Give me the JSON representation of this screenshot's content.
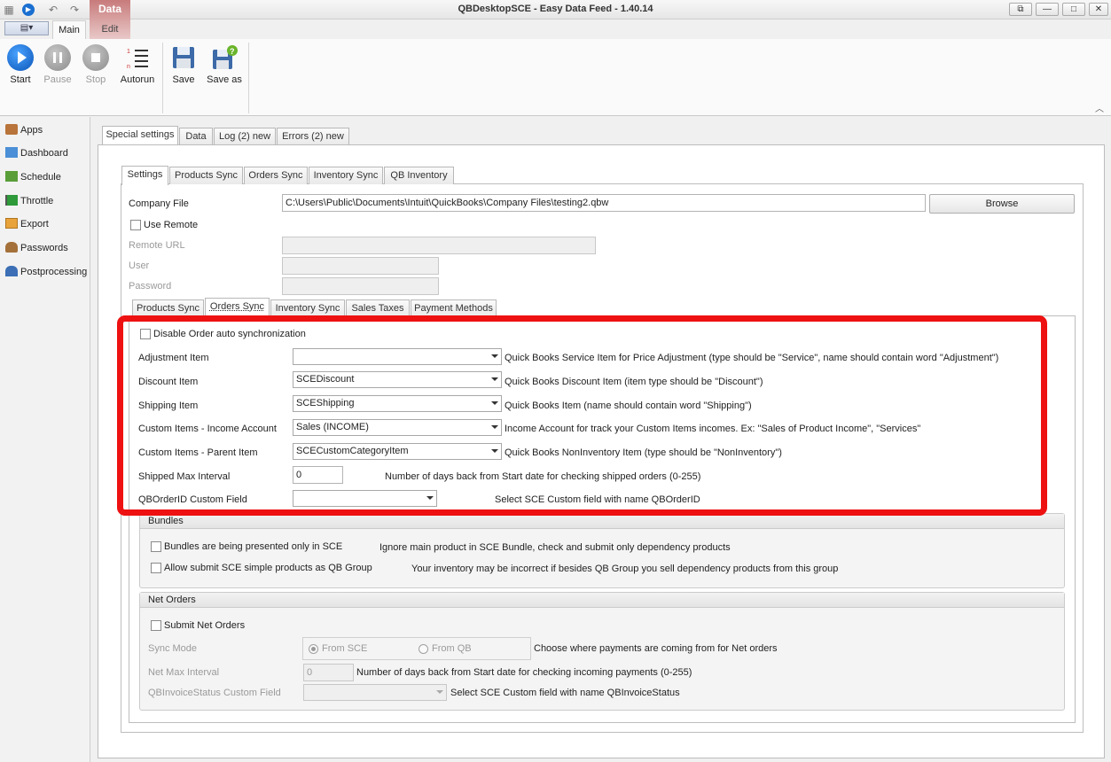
{
  "window": {
    "title": "QBDesktopSCE - Easy Data Feed - 1.40.14",
    "context_tab": "Data",
    "controls": [
      "⧉",
      "—",
      "□",
      "✕"
    ]
  },
  "ribbon": {
    "tabs": [
      "Main",
      "Edit"
    ],
    "buttons": {
      "start": "Start",
      "pause": "Pause",
      "stop": "Stop",
      "autorun": "Autorun",
      "save": "Save",
      "save_as": "Save as"
    }
  },
  "sidebar": {
    "items": [
      "Apps",
      "Dashboard",
      "Schedule",
      "Throttle",
      "Export",
      "Passwords",
      "Postprocessing"
    ]
  },
  "outer_tabs": [
    "Special settings",
    "Data",
    "Log (2) new",
    "Errors (2) new"
  ],
  "settings_tabs": [
    "Settings",
    "Products Sync",
    "Orders Sync",
    "Inventory Sync",
    "QB Inventory"
  ],
  "settings": {
    "company_file_label": "Company File",
    "company_file_value": "C:\\Users\\Public\\Documents\\Intuit\\QuickBooks\\Company Files\\testing2.qbw",
    "browse": "Browse",
    "use_remote": "Use Remote",
    "remote_url": "Remote URL",
    "user": "User",
    "password": "Password"
  },
  "inner_tabs": [
    "Products Sync",
    "Orders Sync",
    "Inventory Sync",
    "Sales Taxes",
    "Payment Methods"
  ],
  "orders": {
    "disable_auto": "Disable Order auto synchronization",
    "rows": [
      {
        "label": "Adjustment Item",
        "value": "",
        "hint": "Quick Books Service Item for Price Adjustment (type should be \"Service\", name should contain word \"Adjustment\")"
      },
      {
        "label": "Discount Item",
        "value": "SCEDiscount",
        "hint": "Quick Books Discount Item (item type should be \"Discount\")"
      },
      {
        "label": "Shipping Item",
        "value": "SCEShipping",
        "hint": "Quick Books Item (name should contain word \"Shipping\")"
      },
      {
        "label": "Custom Items - Income Account",
        "value": "Sales (INCOME)",
        "hint": "Income Account for track your Custom Items incomes. Ex: \"Sales of Product Income\", \"Services\""
      },
      {
        "label": "Custom Items - Parent Item",
        "value": "SCECustomCategoryItem",
        "hint": "Quick Books NonInventory Item (type should be \"NonInventory\")"
      }
    ],
    "shipped_max_label": "Shipped Max Interval",
    "shipped_max_value": "0",
    "shipped_max_hint": "Number of days back from Start date for checking shipped orders  (0-255)",
    "qborderid_label": "QBOrderID Custom Field",
    "qborderid_hint": "Select SCE Custom field with name QBOrderID"
  },
  "bundles": {
    "title": "Bundles",
    "opt1": "Bundles are being  presented only in SCE",
    "opt1_hint": "Ignore main product in SCE Bundle, check and submit only dependency products",
    "opt2": "Allow submit SCE simple products as QB Group",
    "opt2_hint": "Your inventory may be incorrect if besides QB Group you sell dependency products from this group"
  },
  "net_orders": {
    "title": "Net Orders",
    "submit": "Submit Net Orders",
    "sync_mode": "Sync Mode",
    "from_sce": "From SCE",
    "from_qb": "From QB",
    "sync_mode_hint": "Choose where payments are coming from for Net orders",
    "net_max_label": "Net Max Interval",
    "net_max_value": "0",
    "net_max_hint": "Number of days back from Start date for checking incoming payments  (0-255)",
    "invoice_status_label": "QBInvoiceStatus Custom Field",
    "invoice_status_hint": "Select SCE Custom field with name QBInvoiceStatus"
  },
  "colors": {
    "highlight": "#ee1111",
    "context_tab": "#c87b7b",
    "start_blue": "#1a6fd1"
  }
}
